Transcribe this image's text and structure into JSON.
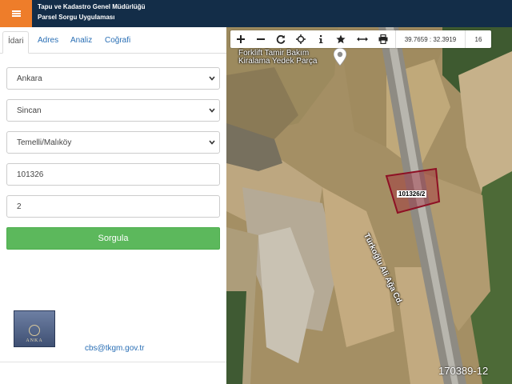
{
  "header": {
    "title_line1": "Tapu ve Kadastro Genel Müdürlüğü",
    "title_line2": "Parsel Sorgu Uygulaması",
    "accent_color": "#ee7d2a",
    "bg_color": "#132d48"
  },
  "tabs": [
    {
      "label": "İdari",
      "active": true
    },
    {
      "label": "Adres",
      "active": false
    },
    {
      "label": "Analiz",
      "active": false
    },
    {
      "label": "Coğrafi",
      "active": false
    }
  ],
  "form": {
    "il": "Ankara",
    "ilce": "Sincan",
    "mahalle": "Temelli/Malıköy",
    "ada": "101326",
    "parsel": "2",
    "submit_label": "Sorgula"
  },
  "footer": {
    "email": "cbs@tkgm.gov.tr",
    "logo_text_main": "ANKA",
    "logo_text_sub": "REFERANS GYD"
  },
  "map": {
    "toolbar_icons": [
      "zoom-in-icon",
      "zoom-out-icon",
      "refresh-icon",
      "locate-icon",
      "info-icon",
      "star-icon",
      "measure-icon",
      "print-icon"
    ],
    "coordinates": "39.7659 : 32.3919",
    "zoom_level": "16",
    "poi_line1": "Forklift Tamir Bakım",
    "poi_line2": "Kiralama Yedek Parça",
    "road_label": "Türkoğlu Ali Ağa Cd.",
    "parcel_label": "101326/2",
    "parcel_color": "#a01830",
    "watermark": "170389-12"
  }
}
